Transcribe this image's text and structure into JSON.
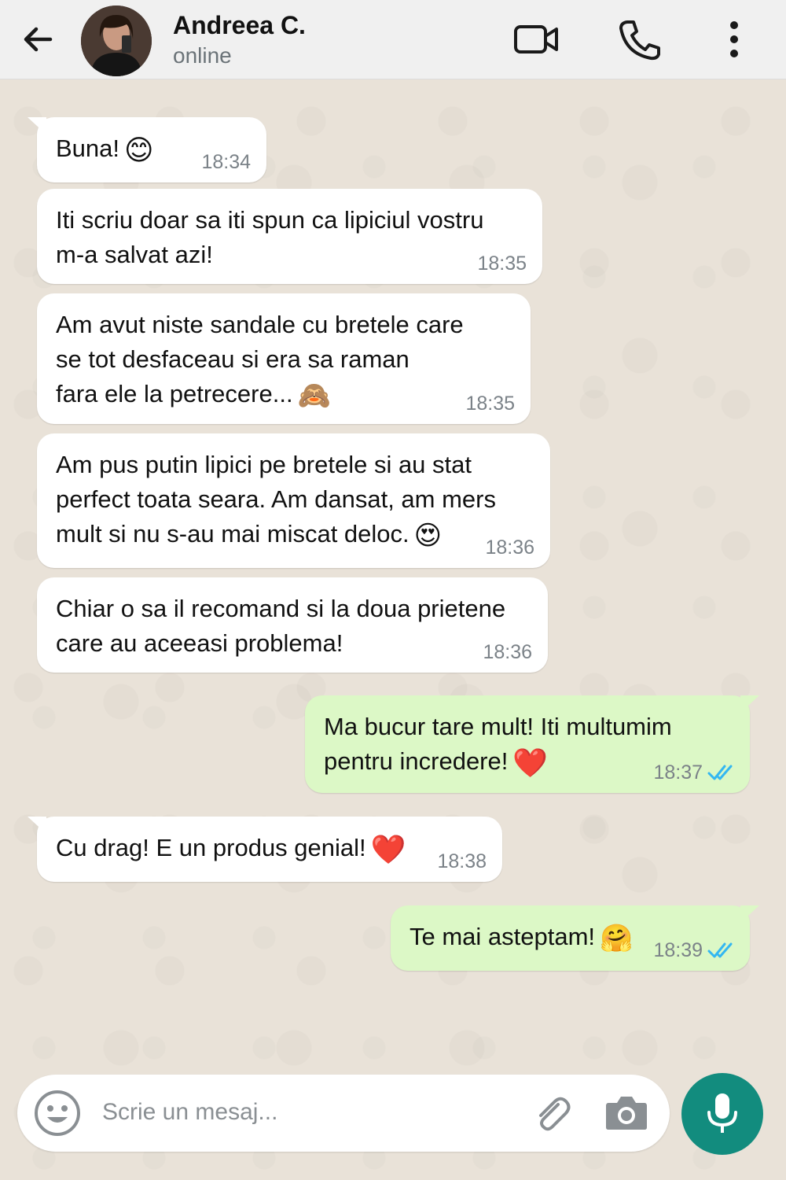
{
  "header": {
    "contact_name": "Andreea C.",
    "status": "online",
    "icons": [
      "back-arrow-icon",
      "avatar",
      "video-call-icon",
      "phone-call-icon",
      "more-options-icon"
    ]
  },
  "messages": [
    {
      "direction": "in",
      "text": "Buna!",
      "emoji": "😊",
      "time": "18:34"
    },
    {
      "direction": "in",
      "text": "Iti scriu doar sa iti spun ca lipiciul vostru\nm-a salvat azi!",
      "time": "18:35"
    },
    {
      "direction": "in",
      "text": "Am avut niste sandale cu bretele care\nse tot desfaceau si era sa raman\nfara ele la petrecere...",
      "emoji": "🙈",
      "time": "18:35"
    },
    {
      "direction": "in",
      "text": "Am pus putin lipici pe bretele si au stat\nperfect toata seara. Am dansat, am mers\nmult si nu s-au mai miscat deloc.",
      "emoji": "😍",
      "time": "18:36"
    },
    {
      "direction": "in",
      "text": "Chiar o sa il recomand si la doua prietene\ncare au aceeasi problema!",
      "time": "18:36"
    },
    {
      "direction": "out",
      "text": "Ma bucur tare mult! Iti multumim\npentru incredere!",
      "emoji": "❤️",
      "time": "18:37",
      "read": true
    },
    {
      "direction": "in",
      "text": "Cu drag! E un produs genial!",
      "emoji": "❤️",
      "time": "18:38"
    },
    {
      "direction": "out",
      "text": "Te mai asteptam!",
      "emoji": "🤗",
      "time": "18:39",
      "read": true
    }
  ],
  "composer": {
    "placeholder": "Scrie un mesaj...",
    "icons": [
      "emoji-icon",
      "attach-icon",
      "camera-icon",
      "mic-icon"
    ]
  },
  "colors": {
    "incoming_bubble": "#ffffff",
    "outgoing_bubble": "#dcf8c6",
    "read_ticks": "#34b7f1",
    "mic_button": "#128c7e",
    "header_bg": "#f0f0f0"
  }
}
